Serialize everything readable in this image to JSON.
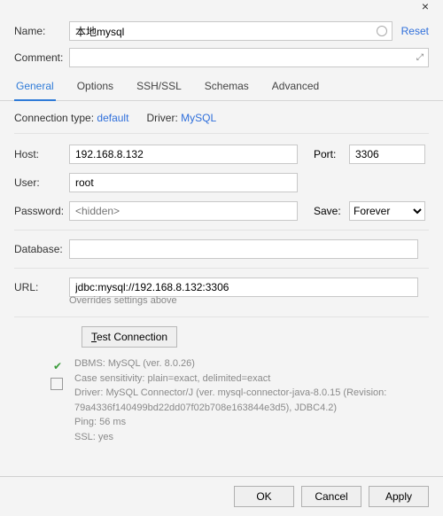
{
  "titlebar": {
    "close": "×"
  },
  "top": {
    "name_label": "Name:",
    "name_value": "本地mysql",
    "comment_label": "Comment:",
    "comment_value": "",
    "reset": "Reset",
    "expand_glyph": "⤢"
  },
  "tabs": {
    "general": "General",
    "options": "Options",
    "ssh": "SSH/SSL",
    "schemas": "Schemas",
    "advanced": "Advanced"
  },
  "conn": {
    "type_label": "Connection type:",
    "type_value": "default",
    "driver_label": "Driver:",
    "driver_value": "MySQL"
  },
  "fields": {
    "host_label": "Host:",
    "host_value": "192.168.8.132",
    "port_label": "Port:",
    "port_value": "3306",
    "user_label": "User:",
    "user_value": "root",
    "password_label": "Password:",
    "password_placeholder": "<hidden>",
    "save_label": "Save:",
    "save_value": "Forever",
    "database_label": "Database:",
    "database_value": "",
    "url_label": "URL:",
    "url_value": "jdbc:mysql://192.168.8.132:3306",
    "url_hint": "Overrides settings above"
  },
  "test": {
    "button": "Test Connection"
  },
  "info": {
    "line1": "DBMS: MySQL (ver. 8.0.26)",
    "line2": "Case sensitivity: plain=exact, delimited=exact",
    "line3": "Driver: MySQL Connector/J (ver. mysql-connector-java-8.0.15 (Revision:",
    "line4": "79a4336f140499bd22dd07f02b708e163844e3d5), JDBC4.2)",
    "line5": "Ping: 56 ms",
    "line6": "SSL: yes"
  },
  "footer": {
    "ok": "OK",
    "cancel": "Cancel",
    "apply": "Apply"
  }
}
